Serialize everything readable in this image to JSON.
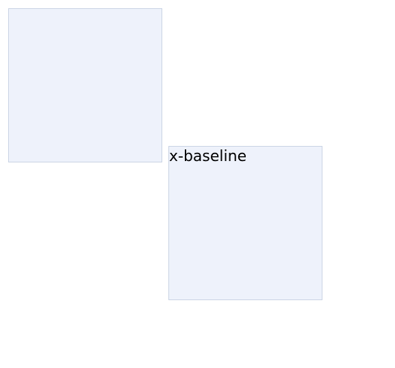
{
  "colors": {
    "box_fill": "#eef2fb",
    "box_border": "#c8d2e3",
    "text": "#000000",
    "background": "#ffffff"
  },
  "boxes": [
    {
      "label": ""
    },
    {
      "label": "x-baseline"
    }
  ]
}
